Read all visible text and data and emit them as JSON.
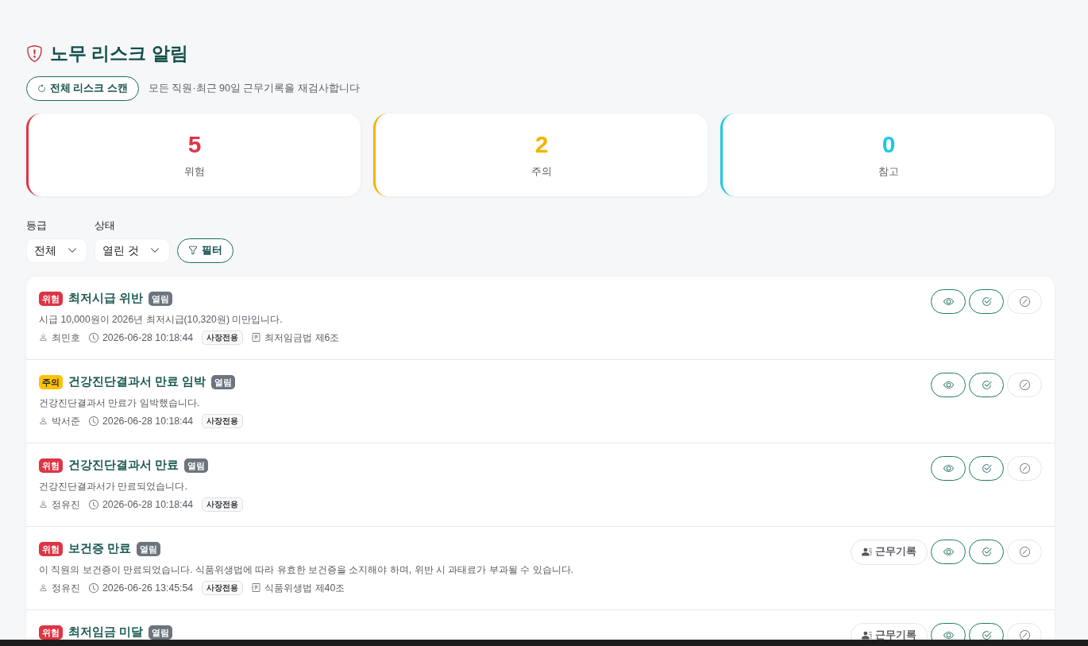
{
  "header": {
    "title": "노무 리스크 알림",
    "scan_button": "전체 리스크 스캔",
    "scan_note": "모든 직원·최근 90일 근무기록을 재검사합니다"
  },
  "stats": [
    {
      "kind": "danger",
      "count": "5",
      "label": "위험"
    },
    {
      "kind": "warning",
      "count": "2",
      "label": "주의"
    },
    {
      "kind": "info",
      "count": "0",
      "label": "참고"
    }
  ],
  "filters": {
    "grade": {
      "label": "등급",
      "value": "전체"
    },
    "status": {
      "label": "상태",
      "value": "열린 것"
    },
    "filter_button": "필터"
  },
  "alerts": [
    {
      "kind": "danger",
      "level_label": "위험",
      "title": "최저시급 위반",
      "status": "열림",
      "description": "시급 10,000원이 2026년 최저시급(10,320원) 미만입니다.",
      "employee": "최민호",
      "time": "2026-06-28 10:18:44",
      "tag": "사장전용",
      "law": "최저임금법 제6조"
    },
    {
      "kind": "warning",
      "level_label": "주의",
      "title": "건강진단결과서 만료 임박",
      "status": "열림",
      "description": "건강진단결과서 만료가 임박했습니다.",
      "employee": "박서준",
      "time": "2026-06-28 10:18:44",
      "tag": "사장전용"
    },
    {
      "kind": "danger",
      "level_label": "위험",
      "title": "건강진단결과서 만료",
      "status": "열림",
      "description": "건강진단결과서가 만료되었습니다.",
      "employee": "정유진",
      "time": "2026-06-28 10:18:44",
      "tag": "사장전용"
    },
    {
      "kind": "danger",
      "level_label": "위험",
      "title": "보건증 만료",
      "status": "열림",
      "description": "이 직원의 보건증이 만료되었습니다. 식품위생법에 따라 유효한 보건증을 소지해야 하며, 위반 시 과태료가 부과될 수 있습니다.",
      "employee": "정유진",
      "time": "2026-06-26 13:45:54",
      "tag": "사장전용",
      "law": "식품위생법 제40조",
      "work_log_button": "근무기록"
    },
    {
      "kind": "danger",
      "level_label": "위험",
      "title": "최저임금 미달",
      "status": "열림",
      "work_log_button": "근무기록"
    }
  ]
}
